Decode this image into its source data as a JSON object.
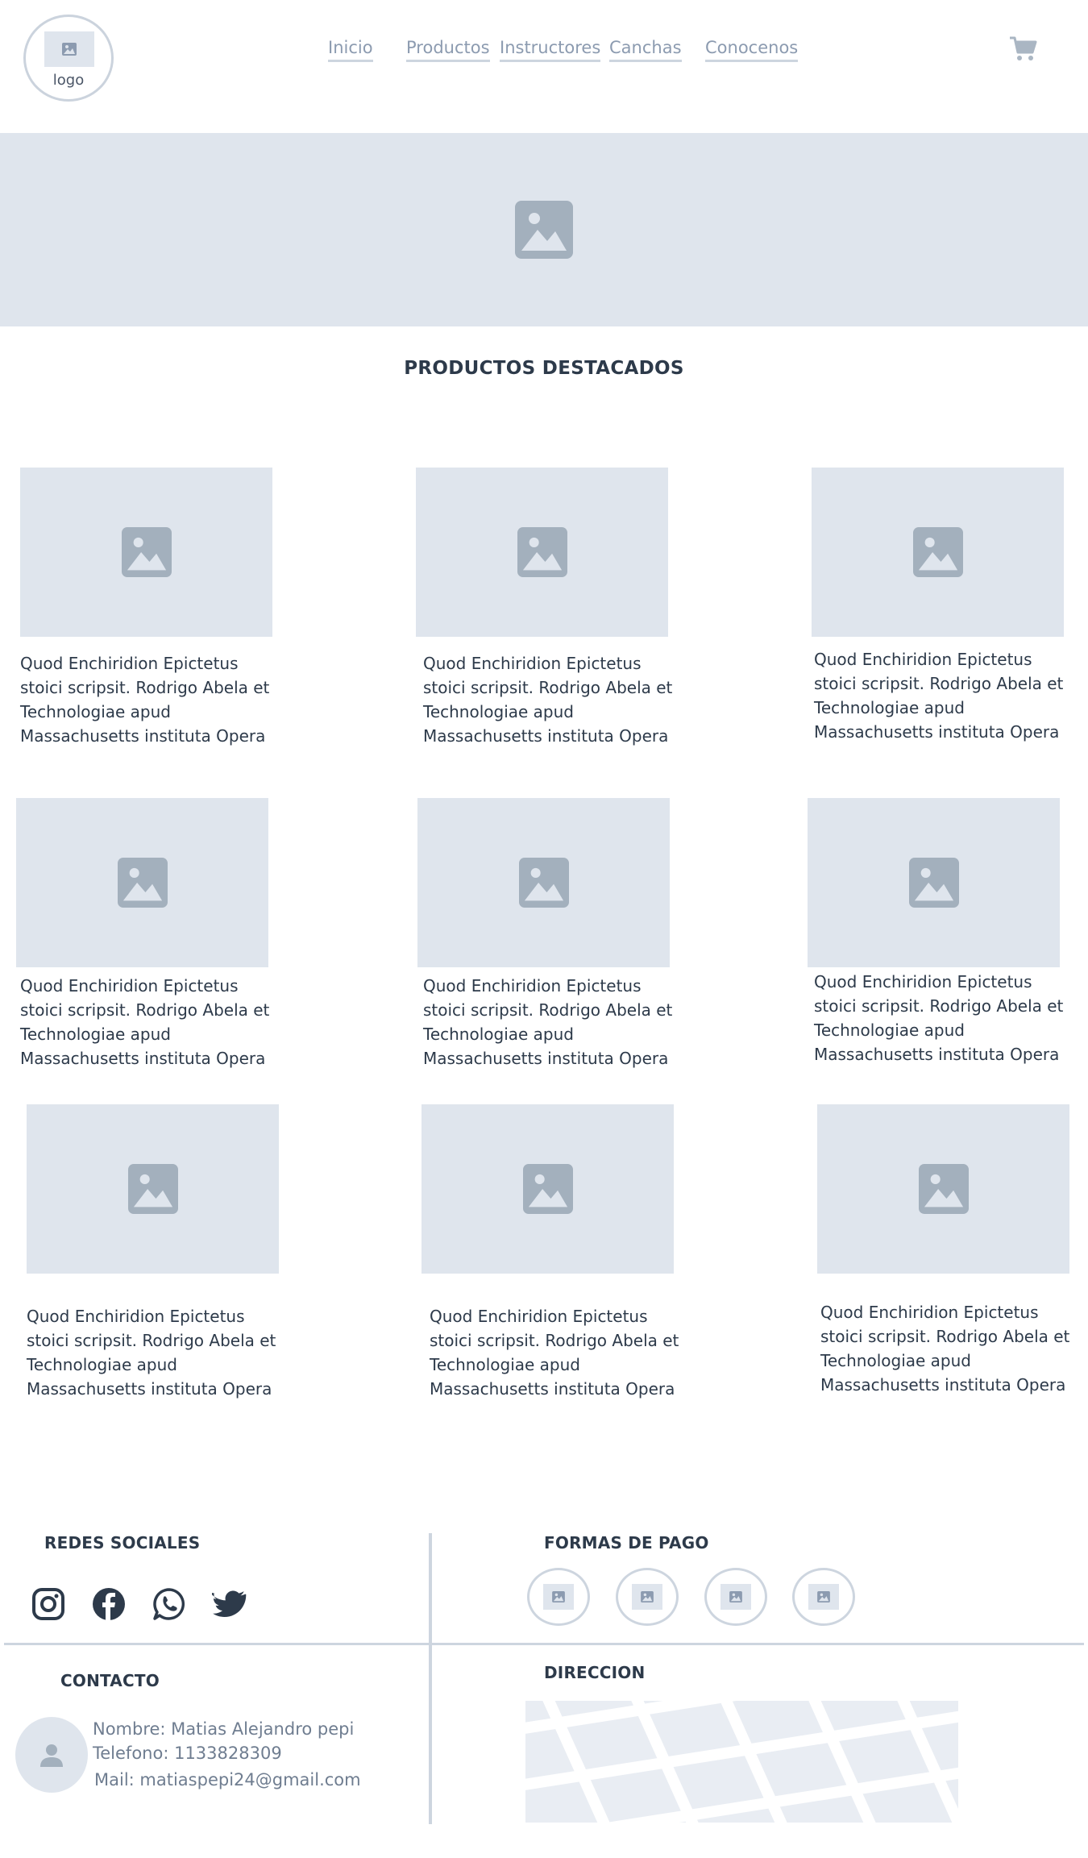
{
  "header": {
    "logo_text": "logo",
    "nav": [
      "Inicio",
      "Productos",
      "Instructores",
      "Canchas",
      "Conocenos"
    ],
    "cart_icon": "cart-icon"
  },
  "hero": {
    "icon": "image-icon"
  },
  "featured": {
    "title": "PRODUCTOS DESTACADOS",
    "products": [
      {
        "line1": "Quod Enchiridion Epictetus",
        "line2": "stoici scripsit. Rodrigo Abela et",
        "line3": "Technologiae apud",
        "line4": "Massachusetts instituta Opera"
      },
      {
        "line1": "Quod Enchiridion Epictetus",
        "line2": "stoici scripsit. Rodrigo Abela et",
        "line3": "Technologiae apud",
        "line4": "Massachusetts instituta Opera"
      },
      {
        "line1": "Quod Enchiridion Epictetus",
        "line2": "stoici scripsit. Rodrigo Abela et",
        "line3": "Technologiae apud",
        "line4": "Massachusetts instituta Opera"
      },
      {
        "line1": "Quod Enchiridion Epictetus",
        "line2": "stoici scripsit. Rodrigo Abela et",
        "line3": "Technologiae apud",
        "line4": "Massachusetts instituta Opera"
      },
      {
        "line1": "Quod Enchiridion Epictetus",
        "line2": "stoici scripsit. Rodrigo Abela et",
        "line3": "Technologiae apud",
        "line4": "Massachusetts instituta Opera"
      },
      {
        "line1": "Quod Enchiridion Epictetus",
        "line2": "stoici scripsit. Rodrigo Abela et",
        "line3": "Technologiae apud",
        "line4": "Massachusetts instituta Opera"
      },
      {
        "line1": "Quod Enchiridion Epictetus",
        "line2": "stoici scripsit. Rodrigo Abela et",
        "line3": "Technologiae apud",
        "line4": "Massachusetts instituta Opera"
      },
      {
        "line1": "Quod Enchiridion Epictetus",
        "line2": "stoici scripsit. Rodrigo Abela et",
        "line3": "Technologiae apud",
        "line4": "Massachusetts instituta Opera"
      },
      {
        "line1": "Quod Enchiridion Epictetus",
        "line2": "stoici scripsit. Rodrigo Abela et",
        "line3": "Technologiae apud",
        "line4": "Massachusetts instituta Opera"
      }
    ]
  },
  "footer": {
    "social_title": "REDES SOCIALES",
    "social_icons": [
      "instagram-icon",
      "facebook-icon",
      "whatsapp-icon",
      "twitter-icon"
    ],
    "payment_title": "FORMAS DE PAGO",
    "contact_title": "CONTACTO",
    "contact": {
      "name": "Nombre: Matias Alejandro pepi",
      "phone": "Telefono: 1133828309",
      "mail": "Mail: matiaspepi24@gmail.com"
    },
    "address_title": "DIRECCION"
  },
  "colors": {
    "placeholder_bg": "#dfe5ed",
    "placeholder_icon": "#a3b0bd",
    "text_dark": "#2d3a4a",
    "text_muted": "#8c9bb0",
    "divider": "#cdd5df"
  }
}
